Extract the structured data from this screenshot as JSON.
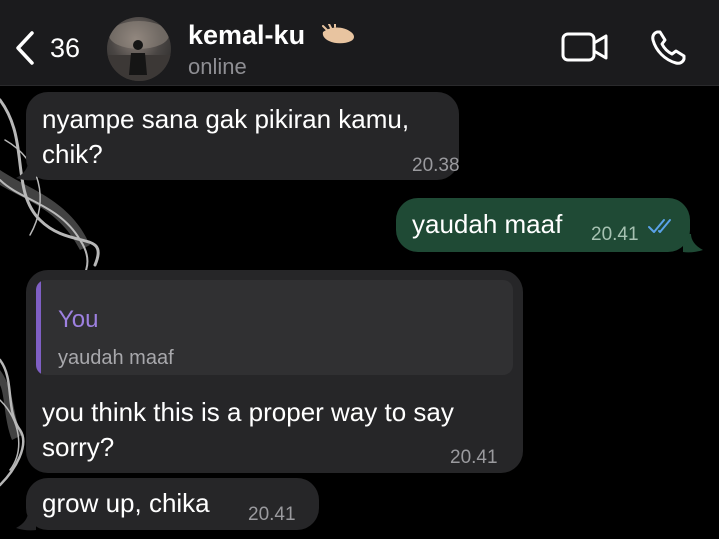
{
  "header": {
    "back_count": "36",
    "contact_name": "kemal-ku",
    "status": "online"
  },
  "messages": [
    {
      "direction": "incoming",
      "text": "nyampe sana gak pikiran kamu, chik?",
      "time": "20.38"
    },
    {
      "direction": "outgoing",
      "text": "yaudah maaf",
      "time": "20.41",
      "read": true
    },
    {
      "direction": "incoming",
      "reply_to": {
        "author": "You",
        "text": "yaudah maaf"
      },
      "text": "you think this is a proper way to say sorry?",
      "time": "20.41"
    },
    {
      "direction": "incoming",
      "text": "grow up, chika",
      "time": "20.41"
    }
  ],
  "colors": {
    "header_bg": "#1b1b1d",
    "incoming_bubble": "#262628",
    "outgoing_bubble": "#1f4a35",
    "reply_accent": "#7f5fc4",
    "read_ticks": "#5aa2e8"
  },
  "icons": [
    "back-chevron-icon",
    "waving-hand-icon",
    "video-camera-icon",
    "phone-icon",
    "read-double-check-icon"
  ]
}
